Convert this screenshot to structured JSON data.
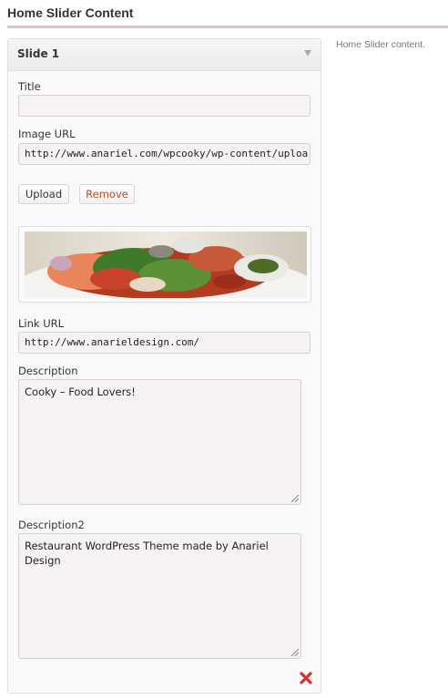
{
  "section": {
    "title": "Home Slider Content",
    "description": "Home Slider content."
  },
  "slide": {
    "title": "Slide 1",
    "fields": {
      "title_label": "Title",
      "title_value": "",
      "image_url_label": "Image URL",
      "image_url_value": "http://www.anariel.com/wpcooky/wp-content/uploa",
      "link_url_label": "Link URL",
      "link_url_value": "http://www.anarieldesign.com/",
      "description_label": "Description",
      "description_value": "Cooky – Food Lovers!",
      "description2_label": "Description2",
      "description2_value": "Restaurant WordPress Theme made by Anariel Design"
    },
    "buttons": {
      "upload": "Upload",
      "remove": "Remove"
    },
    "icons": {
      "collapse": "triangle-down-icon",
      "delete": "red-x-delete-icon"
    }
  },
  "colors": {
    "remove_text": "#c24a24",
    "delete_icon": "#d63232",
    "section_rule": "#d9c9c9"
  }
}
